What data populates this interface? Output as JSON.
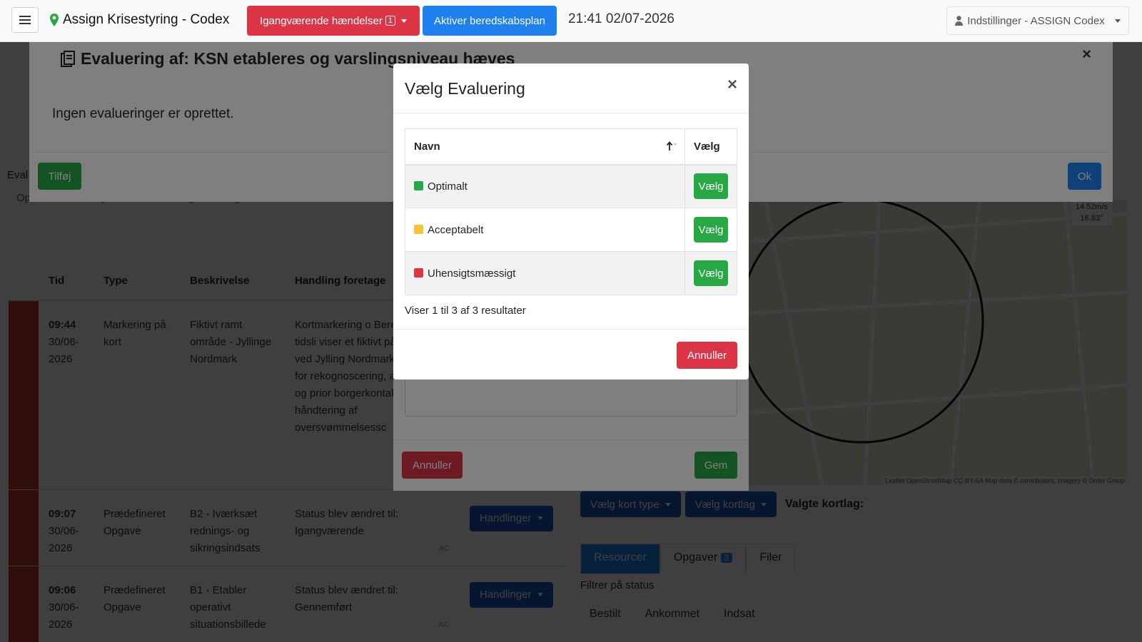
{
  "topbar": {
    "brand": "Assign Krisestyring - Codex",
    "incidents_label": "Igangværende hændelser",
    "incidents_count": "1",
    "activate_plan_label": "Aktiver beredskabsplan",
    "clock": "21:41 02/07-2026",
    "settings_label": "Indstillinger - ASSIGN Codex",
    "colors": {
      "red": "#dc3545",
      "blue": "#1f80f0"
    }
  },
  "background": {
    "table": {
      "headers": [
        "Tid",
        "Type",
        "Beskrivelse",
        "Handling foretage"
      ],
      "rows": [
        {
          "time": "09:44",
          "date": "30/06-2026",
          "type": "Markering på kort",
          "desc": "Fiktivt ramt område - Jyllinge Nordmark",
          "action": "Kortmarkering o Beredskabets tidsli viser et fiktivt påvir område ved Jylling Nordmark, hvor der for rekognoscering, afspærring og prior borgerkontakt. Øve til håndtering af oversvømmelsessc"
        },
        {
          "time": "09:07",
          "date": "30/06-2026",
          "type": "Prædefineret Opgave",
          "desc": "B2 - Iværksæt rednings- og sikringsindsats",
          "action": "Status blev ændret til: Igangværende",
          "sig": "AC"
        },
        {
          "time": "09:06",
          "date": "30/06-2026",
          "type": "Prædefineret Opgave",
          "desc": "B1 - Etabler operativt situationsbillede",
          "action": "Status blev ændret til: Gennemført",
          "sig": "AC"
        }
      ],
      "actions_label": "Handlinger"
    },
    "map_buttons": {
      "layer_type": "Vælg kort type",
      "layers": "Vælg kortlag",
      "selected_layers": "Valgte kortlag:"
    },
    "map_labels": {
      "speed": "14.52m/s",
      "deg": "16.83°",
      "attribution": "Leaflet OpenStreetMap CC-BY-SA Map data © contributors, Imagery © Order Group"
    },
    "tabs": [
      "Resourcer",
      "Opgaver",
      "Filer"
    ],
    "tasks_count": "3",
    "filter_label": "Filtrer på status",
    "filter_options": [
      "Bestilt",
      "Ankommet",
      "Indsat"
    ],
    "cut_labels": [
      "Eval",
      "Optimalt",
      "Acceptabelt",
      "Uhensigtsmæssigt"
    ]
  },
  "eval_modal": {
    "title": "Evaluering af: KSN etableres og varslingsniveau hæves",
    "empty_text": "Ingen evalueringer er oprettet.",
    "add_label": "Tilføj",
    "ok_label": "Ok"
  },
  "behind_modal": {
    "cancel_label": "Annuller",
    "save_label": "Gem"
  },
  "select_modal": {
    "title": "Vælg Evaluering",
    "col_name": "Navn",
    "col_select": "Vælg",
    "options": [
      {
        "name": "Optimalt",
        "color": "#28a745",
        "button": "Vælg"
      },
      {
        "name": "Acceptabelt",
        "color": "#f6c23e",
        "button": "Vælg"
      },
      {
        "name": "Uhensigtsmæssigt",
        "color": "#dc3545",
        "button": "Vælg"
      }
    ],
    "info": "Viser 1 til 3 af 3 resultater",
    "cancel_label": "Annuller"
  }
}
